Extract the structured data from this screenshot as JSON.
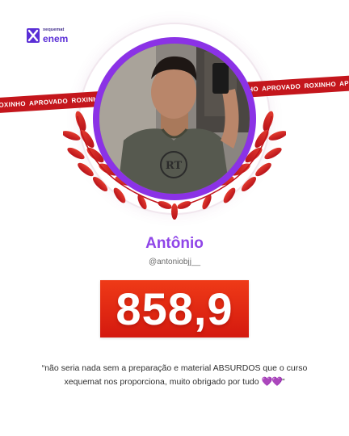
{
  "brand": {
    "top_text": "xequemat",
    "bottom_text": "enem",
    "icon": "xequemat-logo-icon",
    "color": "#5a2ed6"
  },
  "tape": {
    "text": "ROXINHO APROVADO   ROXINHO APROVADO   ROXINHO APROVADO   ROXINHO APROVADO   ROXINHO APROVADO   ROXINHO APROVADO",
    "color": "#c4161c"
  },
  "profile": {
    "photo_icon": "student-photo",
    "name": "Antônio",
    "handle": "@antoniobjj__",
    "accent_color": "#8f45e8"
  },
  "score": {
    "value": "858,9",
    "background": "#e52a14"
  },
  "testimonial": {
    "text": "“não seria nada sem a preparação e material ABSURDOS que o curso xequemat nos proporciona, muito obrigado por tudo",
    "hearts": "💜💜",
    "closing": "”"
  }
}
